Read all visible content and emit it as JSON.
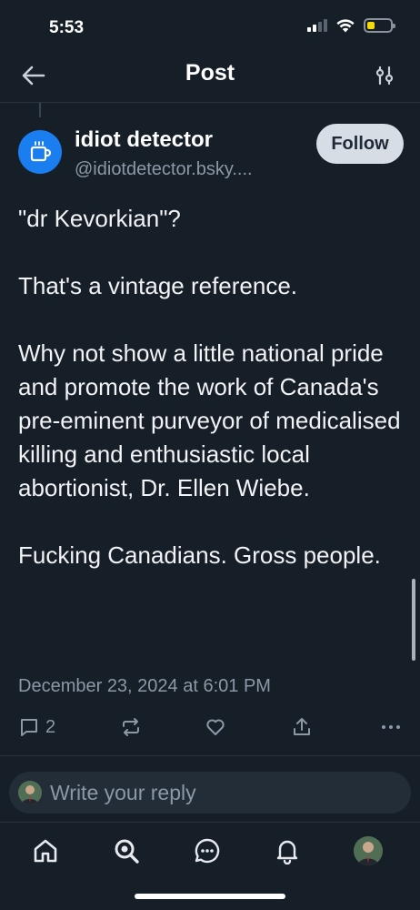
{
  "status_bar": {
    "time": "5:53"
  },
  "header": {
    "title": "Post"
  },
  "author": {
    "name": "idiot detector",
    "handle": "@idiotdetector.bsky....",
    "follow_label": "Follow",
    "avatar_icon": "coffee-cup-icon",
    "avatar_color": "#1a7ef0"
  },
  "post": {
    "paragraphs": [
      "\"dr Kevorkian\"?",
      "That's a vintage reference.",
      "Why not show a little national pride and promote the work of Canada's pre-eminent purveyor of medicalised killing and enthusiastic local abortionist, Dr. Ellen Wiebe.",
      "Fucking Canadians. Gross people."
    ],
    "timestamp": "December 23, 2024 at 6:01 PM"
  },
  "actions": {
    "reply_count": "2",
    "icons": [
      "reply-icon",
      "repost-icon",
      "like-icon",
      "share-icon",
      "more-icon"
    ]
  },
  "composer": {
    "placeholder": "Write your reply"
  },
  "tab_bar": {
    "items": [
      "home-icon",
      "search-icon",
      "chat-icon",
      "notifications-icon",
      "profile-avatar"
    ]
  },
  "colors": {
    "background": "#161e27",
    "text": "#f1f3f5",
    "muted": "#8c98a6",
    "follow_button_bg": "#d7dde4"
  }
}
